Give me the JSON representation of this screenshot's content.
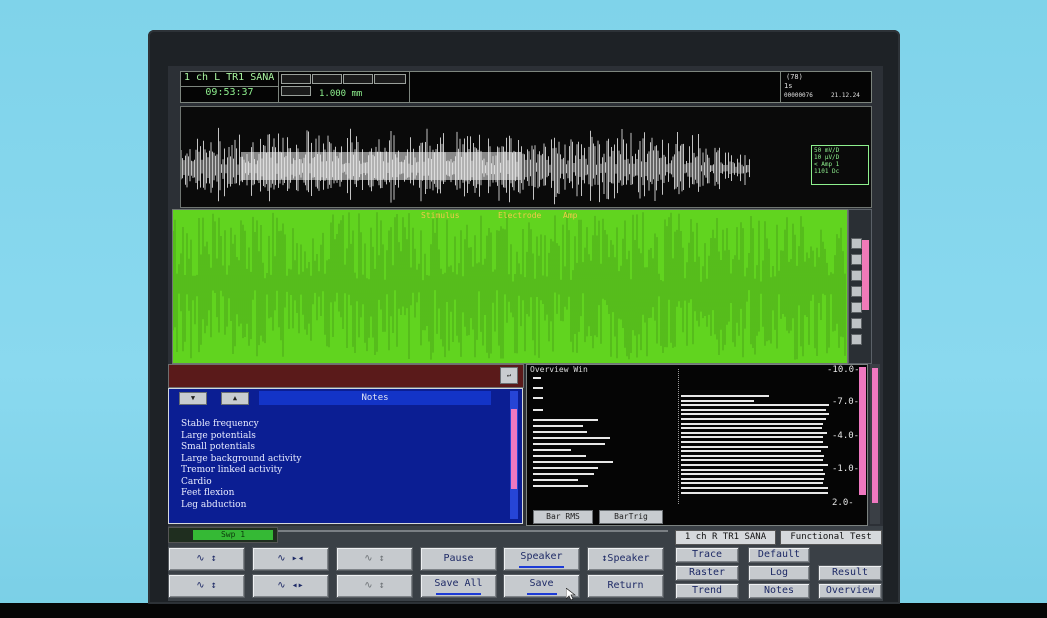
{
  "header": {
    "channel_title": "1 ch L TR1 SANA",
    "time": "09:53:37",
    "depth": "1.000 mm",
    "right_top": "(78)",
    "right_mid": "1s",
    "right_id": "00000076",
    "right_date": "21.12.24"
  },
  "scale_box": {
    "line1": "50 mV/D",
    "line2": "10 µV/D",
    "line3": "< Amp 1",
    "line4": "1101 Dc"
  },
  "overlay_labels": {
    "a": "Stimulus",
    "b": "Electrode",
    "c": "Amp"
  },
  "notes": {
    "title": "Notes",
    "items": [
      "Stable frequency",
      "Large potentials",
      "Small potentials",
      "Large background activity",
      "Tremor linked activity",
      "Cardio",
      "Feet flexion",
      "Leg abduction"
    ]
  },
  "overview": {
    "title": "Overview Win",
    "bar_rms": "Bar RMS",
    "bar_trig": "BarTrig",
    "axis_labels": [
      "-10.0-",
      "-7.0-",
      "-4.0-",
      "-1.0-",
      "2.0-"
    ]
  },
  "sweep": {
    "label": "Swp 1"
  },
  "controls": {
    "pause": "Pause",
    "speaker": "Speaker",
    "ispeaker": "↕Speaker",
    "save_all": "Save All",
    "save": "Save",
    "return": "Return",
    "channel_r": "1 ch R TR1 SANA",
    "functional_test": "Functional Test",
    "trace": "Trace",
    "default": "Default",
    "raster": "Raster",
    "log": "Log",
    "result": "Result",
    "trend": "Trend",
    "notes": "Notes",
    "overview": "Overview",
    "wave_btns": [
      "∿ ↕",
      "∿ ▸◂",
      "∿ ↕",
      "∿ ↕",
      "∿ ◂▸",
      "∿ ↕"
    ]
  }
}
